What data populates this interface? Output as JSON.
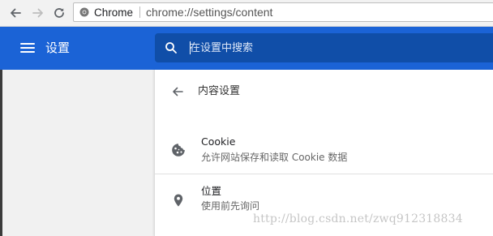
{
  "browser": {
    "chip_label": "Chrome",
    "url": "chrome://settings/content"
  },
  "header": {
    "title": "设置",
    "search_placeholder": "在设置中搜索",
    "accent_color": "#1b63d6",
    "search_bg_color": "#104ea8"
  },
  "content": {
    "section_title": "内容设置",
    "rows": [
      {
        "title": "Cookie",
        "subtitle": "允许网站保存和读取 Cookie 数据",
        "icon": "cookie-icon"
      },
      {
        "title": "位置",
        "subtitle": "使用前先询问",
        "icon": "location-pin-icon"
      }
    ]
  },
  "watermark": "http://blog.csdn.net/zwq912318834"
}
